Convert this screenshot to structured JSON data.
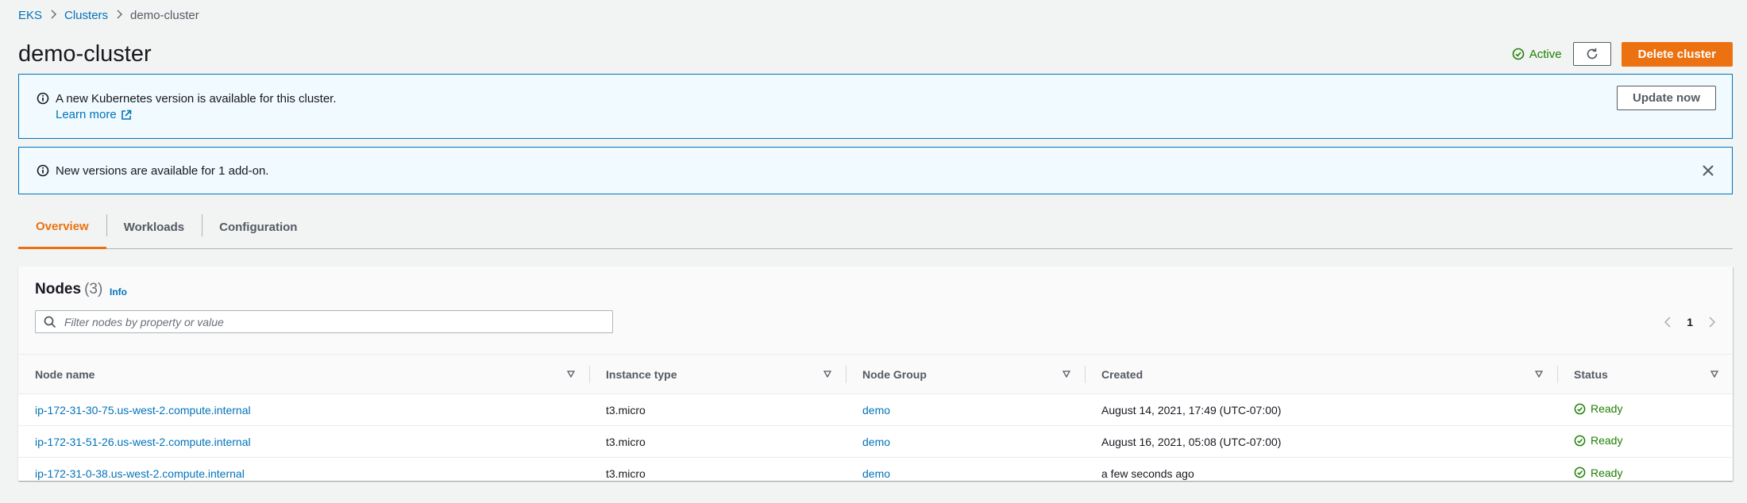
{
  "breadcrumb": {
    "items": [
      "EKS",
      "Clusters"
    ],
    "current": "demo-cluster"
  },
  "header": {
    "title": "demo-cluster",
    "status": "Active",
    "delete_label": "Delete cluster"
  },
  "alerts": [
    {
      "text": "A new Kubernetes version is available for this cluster.",
      "link": "Learn more",
      "action": "Update now"
    },
    {
      "text": "New versions are available for 1 add-on."
    }
  ],
  "tabs": [
    {
      "label": "Overview",
      "active": true
    },
    {
      "label": "Workloads",
      "active": false
    },
    {
      "label": "Configuration",
      "active": false
    }
  ],
  "nodes": {
    "title": "Nodes",
    "count": "(3)",
    "info": "Info",
    "filter_placeholder": "Filter nodes by property or value",
    "page": "1",
    "columns": [
      "Node name",
      "Instance type",
      "Node Group",
      "Created",
      "Status"
    ],
    "rows": [
      {
        "name": "ip-172-31-30-75.us-west-2.compute.internal",
        "instance_type": "t3.micro",
        "node_group": "demo",
        "created": "August 14, 2021, 17:49 (UTC-07:00)",
        "status": "Ready"
      },
      {
        "name": "ip-172-31-51-26.us-west-2.compute.internal",
        "instance_type": "t3.micro",
        "node_group": "demo",
        "created": "August 16, 2021, 05:08 (UTC-07:00)",
        "status": "Ready"
      },
      {
        "name": "ip-172-31-0-38.us-west-2.compute.internal",
        "instance_type": "t3.micro",
        "node_group": "demo",
        "created": "a few seconds ago",
        "status": "Ready"
      }
    ]
  },
  "colors": {
    "accent": "#ec7211",
    "link": "#0073bb",
    "success": "#1d8102",
    "info_bg": "#f1faff"
  }
}
